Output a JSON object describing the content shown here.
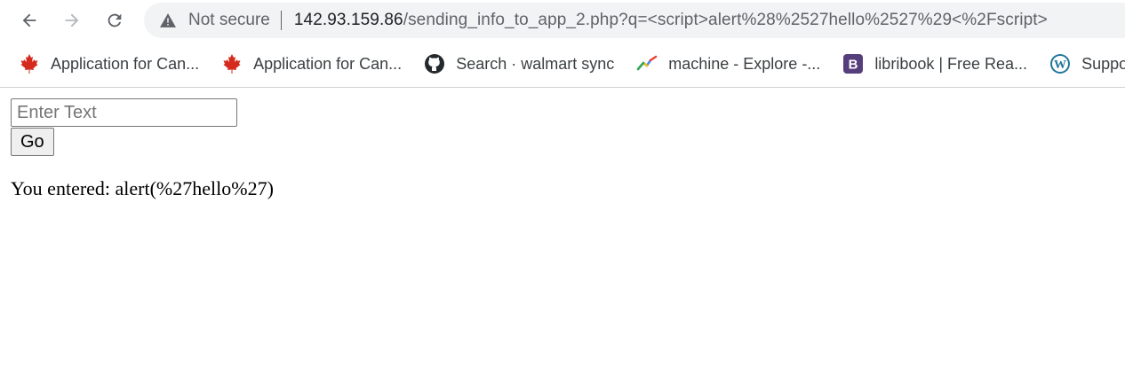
{
  "browser": {
    "security_label": "Not secure",
    "url_host": "142.93.159.86",
    "url_path": "/sending_info_to_app_2.php?q=<script>alert%28%2527hello%2527%29<%2Fscript>",
    "bookmarks": [
      {
        "label": "Application for Can...",
        "icon": "maple-leaf-icon"
      },
      {
        "label": "Application for Can...",
        "icon": "maple-leaf-icon"
      },
      {
        "label": "Search · walmart sync",
        "icon": "github-icon"
      },
      {
        "label": "machine - Explore -...",
        "icon": "trends-icon"
      },
      {
        "label": "libribook | Free Rea...",
        "icon": "bootstrap-b-icon"
      },
      {
        "label": "Support",
        "icon": "wordpress-icon"
      }
    ]
  },
  "page": {
    "input_placeholder": "Enter Text",
    "input_value": "",
    "go_label": "Go",
    "result_text": "You entered: alert(%27hello%27)"
  },
  "colors": {
    "maple": "#d52b1e",
    "bootstrap": "#563d7c",
    "wordpress": "#21759b"
  }
}
